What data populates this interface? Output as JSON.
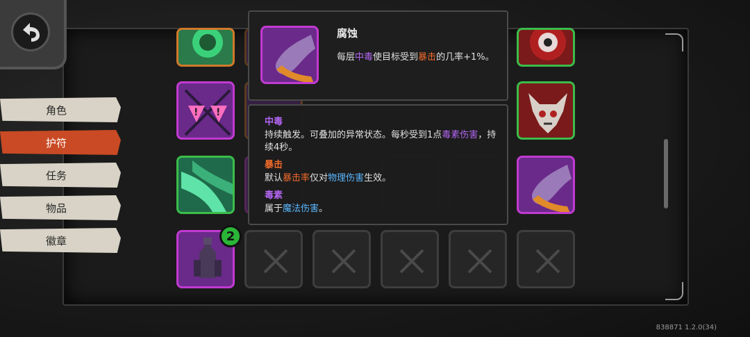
{
  "menu": {
    "items": [
      {
        "label": "角色",
        "active": false
      },
      {
        "label": "护符",
        "active": true
      },
      {
        "label": "任务",
        "active": false
      },
      {
        "label": "物品",
        "active": false
      },
      {
        "label": "徽章",
        "active": false
      }
    ]
  },
  "slot_badge": "2",
  "tooltip": {
    "title": "腐蚀",
    "desc_parts": [
      {
        "text": "每层",
        "color": "normal"
      },
      {
        "text": "中毒",
        "color": "purple"
      },
      {
        "text": "使目标受到",
        "color": "normal"
      },
      {
        "text": "暴击",
        "color": "orange"
      },
      {
        "text": "的几率+1%。",
        "color": "normal"
      }
    ]
  },
  "glossary": [
    {
      "term": "中毒",
      "term_color": "purple",
      "body": [
        {
          "text": "持续触发。可叠加的异常状态。每秒受到1点",
          "color": "normal"
        },
        {
          "text": "毒素伤害",
          "color": "purple"
        },
        {
          "text": "，持续4秒。",
          "color": "normal"
        }
      ]
    },
    {
      "term": "暴击",
      "term_color": "orange",
      "body": [
        {
          "text": "默认",
          "color": "normal"
        },
        {
          "text": "暴击率",
          "color": "orange"
        },
        {
          "text": "仅对",
          "color": "normal"
        },
        {
          "text": "物理伤害",
          "color": "cyan"
        },
        {
          "text": "生效。",
          "color": "normal"
        }
      ]
    },
    {
      "term": "毒素",
      "term_color": "purple",
      "body": [
        {
          "text": "属于",
          "color": "normal"
        },
        {
          "text": "魔法伤害",
          "color": "cyan"
        },
        {
          "text": "。",
          "color": "normal"
        }
      ]
    }
  ],
  "version": "838871 1.2.0(34)",
  "icons": {
    "back": "back-arrow-icon",
    "empty_slot": "x-mark-icon"
  }
}
